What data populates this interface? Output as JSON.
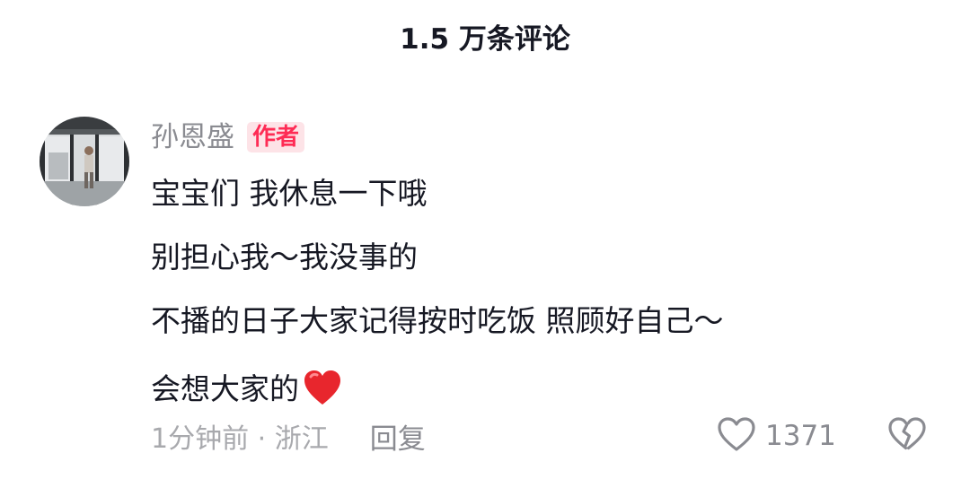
{
  "header": {
    "title": "1.5 万条评论"
  },
  "comment": {
    "author": "孙恩盛",
    "badge": "作者",
    "lines": [
      "宝宝们 我休息一下哦",
      "别担心我～我没事的",
      "不播的日子大家记得按时吃饭 照顾好自己～",
      "会想大家的"
    ],
    "emoji": "red-heart",
    "time_location": "1分钟前 · 浙江",
    "reply_label": "回复",
    "like_count": "1371"
  },
  "icons": {
    "like": "heart-outline-icon",
    "dislike": "broken-heart-icon"
  },
  "colors": {
    "badge_text": "#fe2c55",
    "badge_bg": "#fde3e7",
    "heart_emoji": "#e8262d"
  }
}
